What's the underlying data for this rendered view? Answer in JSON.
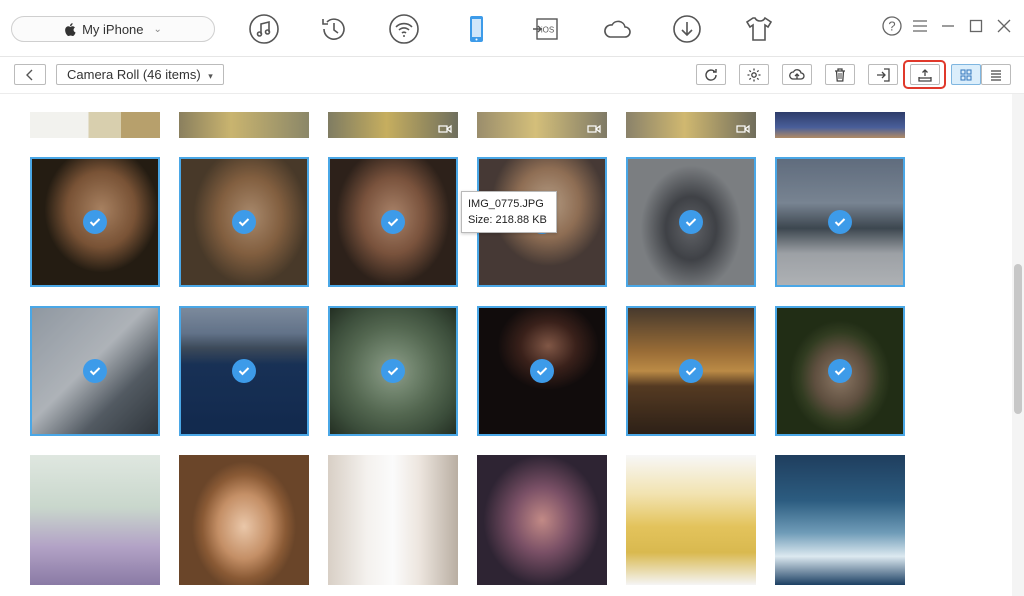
{
  "device": {
    "name": "My iPhone"
  },
  "toolbar": {
    "album_label": "Camera Roll (46 items)"
  },
  "tooltip": {
    "filename": "IMG_0775.JPG",
    "size": "Size: 218.88 KB"
  },
  "nav_icons": [
    "music-icon",
    "history-icon",
    "wifi-icon",
    "phone-icon",
    "ios-icon",
    "cloud-icon",
    "download-icon",
    "tshirt-icon"
  ],
  "nav_ios_text": "iOS",
  "colors": {
    "accent": "#3d9be9",
    "highlight": "#e0392b",
    "selected_border": "#4aa7e6"
  },
  "photos": {
    "top_row": [
      {
        "desc": "map",
        "video": false
      },
      {
        "desc": "yellow-flower",
        "video": false
      },
      {
        "desc": "yellow-flower",
        "video": true
      },
      {
        "desc": "yellow-flower",
        "video": true
      },
      {
        "desc": "yellow-flower",
        "video": true
      },
      {
        "desc": "city-skyline",
        "video": false
      }
    ],
    "row1_selected": true,
    "row2_selected": true,
    "row3_selected": false
  }
}
